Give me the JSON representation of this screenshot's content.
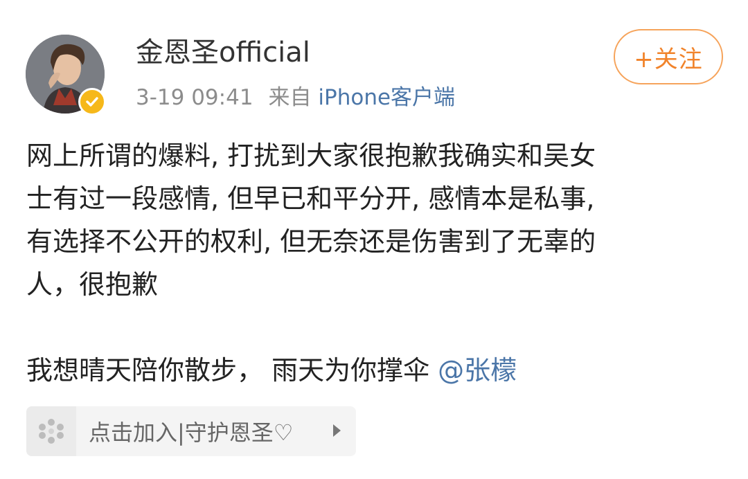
{
  "author": {
    "name": "金恩圣official",
    "avatar_icon": "user-avatar-photo",
    "verified_icon": "verified-check-icon",
    "verified_color": "#f6b81a"
  },
  "post_meta": {
    "time": "3-19 09:41",
    "source_prefix": "来自",
    "source_device": "iPhone客户端"
  },
  "follow_button": {
    "label": "+关注",
    "color": "#f1832a"
  },
  "post": {
    "paragraph1": [
      "网上所谓的爆料, 打扰到大家很抱歉我确实和吴女",
      "士有过一段感情, 但早已和平分开, 感情本是私事,",
      "有选择不公开的权利, 但无奈还是伤害到了无辜的",
      "人，很抱歉"
    ],
    "paragraph2_text": "我想晴天陪你散步， 雨天为你撑伞 ",
    "mention": "@张檬",
    "link_color": "#4b76a8"
  },
  "super_topic": {
    "icon": "supertopic-flower-icon",
    "label": "点击加入|守护恩圣♡",
    "arrow_icon": "chevron-right-icon"
  }
}
